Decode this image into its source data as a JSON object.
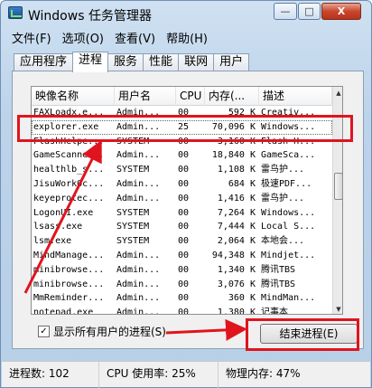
{
  "window": {
    "title": "Windows 任务管理器",
    "min_glyph": "—",
    "max_glyph": "□",
    "close_glyph": "X"
  },
  "menu": [
    "文件(F)",
    "选项(O)",
    "查看(V)",
    "帮助(H)"
  ],
  "tabs": [
    "应用程序",
    "进程",
    "服务",
    "性能",
    "联网",
    "用户"
  ],
  "active_tab": 1,
  "columns": [
    "映像名称",
    "用户名",
    "CPU",
    "内存(...",
    "描述"
  ],
  "processes": [
    {
      "name": "FAXLoadx.e...",
      "user": "Admin...",
      "cpu": "00",
      "mem": "592 K",
      "desc": "Creativ..."
    },
    {
      "name": "explorer.exe",
      "user": "Admin...",
      "cpu": "25",
      "mem": "70,096 K",
      "desc": "Windows..."
    },
    {
      "name": "FlashHelpe...",
      "user": "SYSTEM",
      "cpu": "00",
      "mem": "3,160 K",
      "desc": "Flash H..."
    },
    {
      "name": "GameScanne...",
      "user": "Admin...",
      "cpu": "00",
      "mem": "18,840 K",
      "desc": "GameSca..."
    },
    {
      "name": "healthlb_s...",
      "user": "SYSTEM",
      "cpu": "00",
      "mem": "1,108 K",
      "desc": "雷鸟护..."
    },
    {
      "name": "JisuWorkOc...",
      "user": "Admin...",
      "cpu": "00",
      "mem": "684 K",
      "desc": "极速PDF..."
    },
    {
      "name": "keyeprotec...",
      "user": "Admin...",
      "cpu": "00",
      "mem": "1,416 K",
      "desc": "雷鸟护..."
    },
    {
      "name": "LogonUI.exe",
      "user": "SYSTEM",
      "cpu": "00",
      "mem": "7,264 K",
      "desc": "Windows..."
    },
    {
      "name": "lsass.exe",
      "user": "SYSTEM",
      "cpu": "00",
      "mem": "7,444 K",
      "desc": "Local S..."
    },
    {
      "name": "lsm.exe",
      "user": "SYSTEM",
      "cpu": "00",
      "mem": "2,064 K",
      "desc": "本地会..."
    },
    {
      "name": "MindManage...",
      "user": "Admin...",
      "cpu": "00",
      "mem": "94,348 K",
      "desc": "Mindjet..."
    },
    {
      "name": "minibrowse...",
      "user": "Admin...",
      "cpu": "00",
      "mem": "1,340 K",
      "desc": "腾讯TBS"
    },
    {
      "name": "minibrowse...",
      "user": "Admin...",
      "cpu": "00",
      "mem": "3,076 K",
      "desc": "腾讯TBS"
    },
    {
      "name": "MmReminder...",
      "user": "Admin...",
      "cpu": "00",
      "mem": "360 K",
      "desc": "MindMan..."
    },
    {
      "name": "notepad.exe",
      "user": "Admin...",
      "cpu": "00",
      "mem": "1,380 K",
      "desc": "记事本"
    }
  ],
  "selected_row": 1,
  "show_all_users": {
    "label": "显示所有用户的进程(S)",
    "checked": true,
    "check_glyph": "✓"
  },
  "end_process_label": "结束进程(E)",
  "status": {
    "processes": "进程数: 102",
    "cpu": "CPU 使用率: 25%",
    "memory": "物理内存: 47%"
  },
  "scroll": {
    "up_glyph": "▲",
    "down_glyph": "▼"
  },
  "annotation_color": "#e0141e"
}
